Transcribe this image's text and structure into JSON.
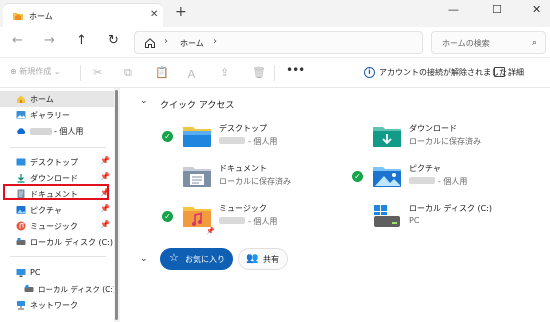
{
  "tab": {
    "title": "ホーム",
    "close_glyph": "✕",
    "icon": "home-folder-icon"
  },
  "newtab_glyph": "+",
  "window": {
    "min": "—",
    "max": "☐",
    "close": "✕"
  },
  "nav": {
    "back": "←",
    "forward": "→",
    "up": "↑",
    "refresh": "↻"
  },
  "address": {
    "crumb": "ホーム",
    "sep": "›"
  },
  "search": {
    "placeholder": "ホームの検索",
    "icon_glyph": "⌕"
  },
  "toolbar": {
    "new_label": "⊕ 新規作成 ⌄",
    "more_glyph": "•••",
    "info_glyph": "i",
    "info_text": "アカウントの接続が解除されました",
    "details_label": "詳細",
    "cut": "✂",
    "copy": "⧉",
    "paste": "📋",
    "rename": "Ａ",
    "share": "⇪",
    "delete": "🗑"
  },
  "sidebar": {
    "items": [
      {
        "label": "ホーム",
        "icon": "home-icon"
      },
      {
        "label": "ギャラリー",
        "icon": "gallery-icon"
      },
      {
        "label": "- 個人用",
        "icon": "onedrive-icon"
      },
      {
        "label": "デスクトップ",
        "icon": "desktop-icon"
      },
      {
        "label": "ダウンロード",
        "icon": "download-icon"
      },
      {
        "label": "ドキュメント",
        "icon": "documents-icon"
      },
      {
        "label": "ピクチャ",
        "icon": "pictures-icon"
      },
      {
        "label": "ミュージック",
        "icon": "music-icon"
      },
      {
        "label": "ローカル ディスク (C:)",
        "icon": "drive-icon"
      },
      {
        "label": "PC",
        "icon": "pc-icon"
      },
      {
        "label": "ローカル ディスク (C:)",
        "icon": "drive-icon"
      },
      {
        "label": "ネットワーク",
        "icon": "network-icon"
      }
    ],
    "pin_glyph": "📌"
  },
  "main": {
    "quick_access": "クイック アクセス",
    "chevron": "⌄",
    "items": [
      {
        "name": "デスクトップ",
        "sub": "- 個人用",
        "icon": "desktop-folder-icon"
      },
      {
        "name": "ダウンロード",
        "sub": "ローカルに保存済み",
        "icon": "download-folder-icon"
      },
      {
        "name": "ドキュメント",
        "sub": "ローカルに保存済み",
        "icon": "documents-folder-icon"
      },
      {
        "name": "ピクチャ",
        "sub": "- 個人用",
        "icon": "pictures-folder-icon"
      },
      {
        "name": "ミュージック",
        "sub": "- 個人用",
        "icon": "music-folder-icon"
      },
      {
        "name": "ローカル ディスク (C:)",
        "sub": "PC",
        "icon": "windows-drive-icon"
      }
    ],
    "check_glyph": "✓",
    "favorites": "お気に入り",
    "shared": "共有",
    "star_glyph": "☆",
    "people_glyph": "👥"
  },
  "colors": {
    "accent": "#0f5fb4",
    "sync_green": "#16a34a",
    "highlight_red": "#e0101c"
  }
}
